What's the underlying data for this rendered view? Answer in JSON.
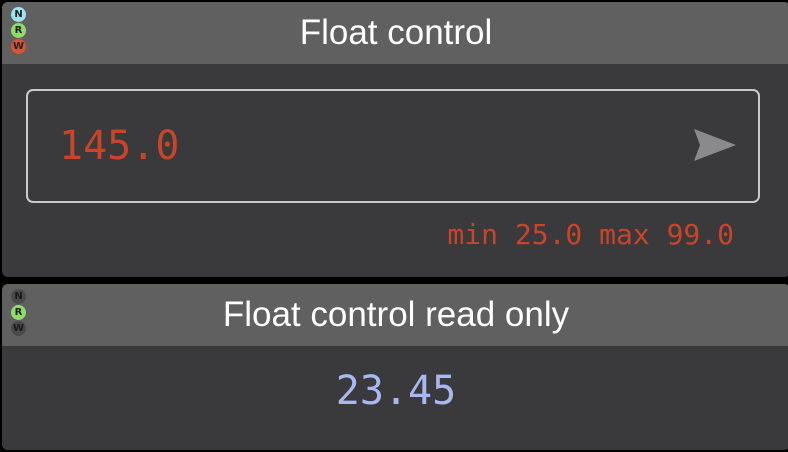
{
  "colors": {
    "panel_bg": "#3a393c",
    "header_bg": "#606061",
    "accent_red": "#c8452a",
    "readonly_blue": "#a8b8f0",
    "badge_n_active": "#9ce3ee",
    "badge_r_active": "#8fdc6a",
    "badge_w_active": "#d9542e",
    "badge_inactive": "#4a4a4a"
  },
  "float_control": {
    "title": "Float control",
    "badges": [
      {
        "letter": "N",
        "active": true
      },
      {
        "letter": "R",
        "active": true
      },
      {
        "letter": "W",
        "active": true
      }
    ],
    "input_value": "145.0",
    "send_icon": "send-arrow-icon",
    "range_text": "min 25.0 max 99.0"
  },
  "float_control_read_only": {
    "title": "Float control read only",
    "badges": [
      {
        "letter": "N",
        "active": false
      },
      {
        "letter": "R",
        "active": true
      },
      {
        "letter": "W",
        "active": false
      }
    ],
    "value": "23.45"
  }
}
